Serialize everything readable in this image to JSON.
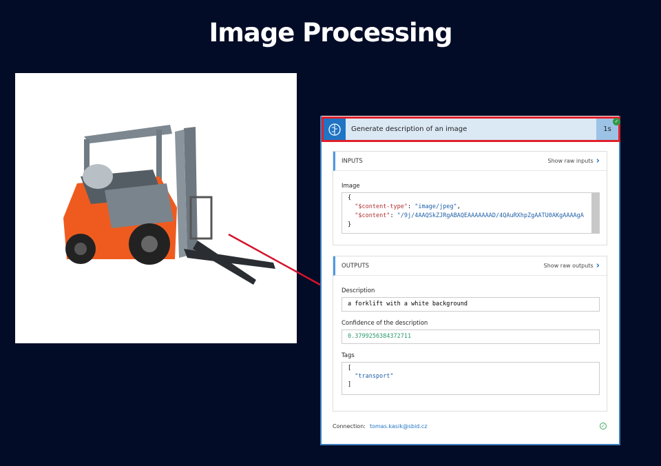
{
  "title": "Image Processing",
  "action": {
    "name": "Generate description of an image",
    "duration": "1s"
  },
  "inputs": {
    "header": "INPUTS",
    "raw_link": "Show raw inputs",
    "image_label": "Image",
    "json_open": "{",
    "key1": "\"$content-type\"",
    "val1": "\"image/jpeg\"",
    "key2": "\"$content\"",
    "val2": "\"/9j/4AAQSkZJRgABAQEAAAAAAAD/4QAuRXhpZgAATU0AKgAAAAgA",
    "json_close": "}"
  },
  "outputs": {
    "header": "OUTPUTS",
    "raw_link": "Show raw outputs",
    "description_label": "Description",
    "description": "a forklift with a white background",
    "confidence_label": "Confidence of the description",
    "confidence": "0.3799256384372711",
    "tags_label": "Tags",
    "tags_open": "[",
    "tag1": "\"transport\"",
    "tags_close": "]"
  },
  "connection": {
    "label": "Connection:",
    "account": "tomas.kasik@sbid.cz"
  },
  "colors": {
    "background": "#030c26",
    "highlight": "#e0202b",
    "accent": "#1f74c4"
  }
}
